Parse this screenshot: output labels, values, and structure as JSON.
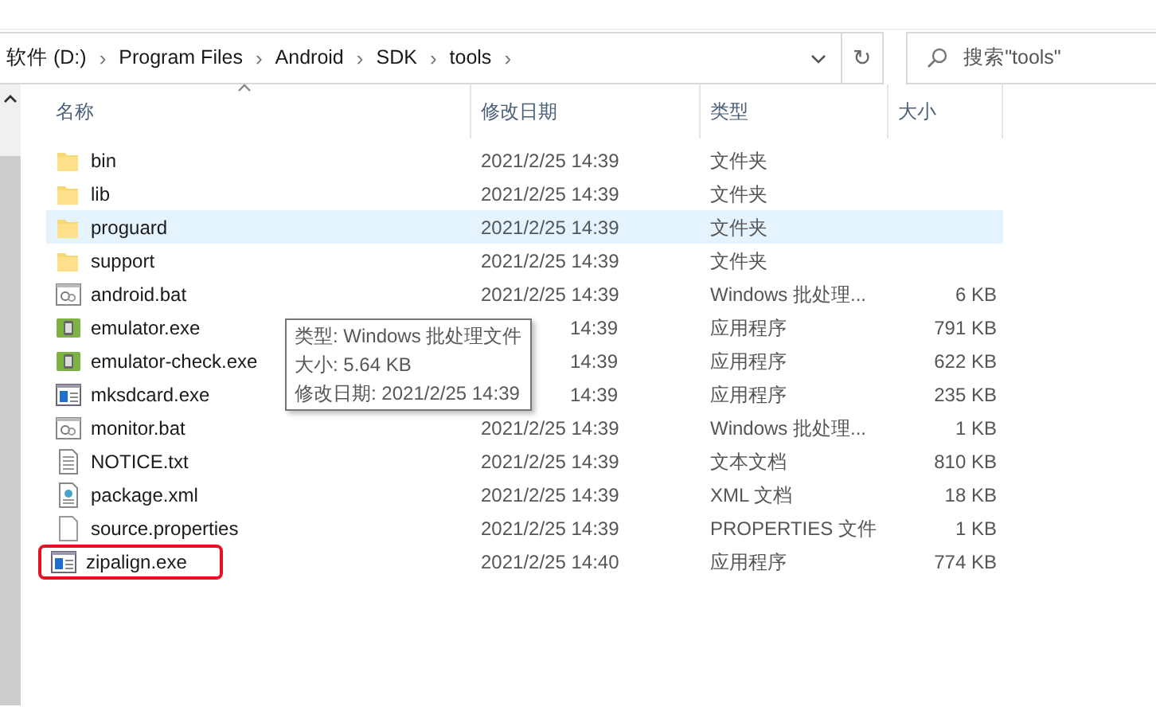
{
  "address_bar": {
    "crumbs": [
      "软件 (D:)",
      "Program Files",
      "Android",
      "SDK",
      "tools"
    ],
    "separator": "›",
    "refresh": "↻"
  },
  "search": {
    "placeholder": "搜索\"tools\""
  },
  "columns": [
    {
      "label": "名称",
      "sorted": true
    },
    {
      "label": "修改日期",
      "sorted": false
    },
    {
      "label": "类型",
      "sorted": false
    },
    {
      "label": "大小",
      "sorted": false
    }
  ],
  "files": [
    {
      "name": "bin",
      "kind": "folder",
      "date": "2021/2/25 14:39",
      "type": "文件夹",
      "hovered": false,
      "marked": false
    },
    {
      "name": "lib",
      "kind": "folder",
      "date": "2021/2/25 14:39",
      "type": "文件夹",
      "hovered": false,
      "marked": false
    },
    {
      "name": "proguard",
      "kind": "folder",
      "date": "2021/2/25 14:39",
      "type": "文件夹",
      "hovered": true,
      "marked": false
    },
    {
      "name": "support",
      "kind": "folder",
      "date": "2021/2/25 14:39",
      "type": "文件夹",
      "hovered": false,
      "marked": false
    },
    {
      "name": "android.bat",
      "kind": "batch",
      "date": "2021/2/25 14:39",
      "type": "Windows 批处理...",
      "size": "6 KB",
      "hovered": false,
      "marked": false
    },
    {
      "name": "emulator.exe",
      "kind": "emulator",
      "date": "14:39",
      "covered": true,
      "type": "应用程序",
      "size": "791 KB",
      "hovered": false,
      "marked": false
    },
    {
      "name": "emulator-check.exe",
      "kind": "emulator",
      "date": "14:39",
      "covered": true,
      "type": "应用程序",
      "size": "622 KB",
      "hovered": false,
      "marked": false
    },
    {
      "name": "mksdcard.exe",
      "kind": "app",
      "date": "14:39",
      "covered": true,
      "type": "应用程序",
      "size": "235 KB",
      "hovered": false,
      "marked": false
    },
    {
      "name": "monitor.bat",
      "kind": "batch",
      "date": "2021/2/25 14:39",
      "type": "Windows 批处理...",
      "size": "1 KB",
      "hovered": false,
      "marked": false
    },
    {
      "name": "NOTICE.txt",
      "kind": "text",
      "date": "2021/2/25 14:39",
      "type": "文本文档",
      "size": "810 KB",
      "hovered": false,
      "marked": false
    },
    {
      "name": "package.xml",
      "kind": "xml",
      "date": "2021/2/25 14:39",
      "type": "XML 文档",
      "size": "18 KB",
      "hovered": false,
      "marked": false
    },
    {
      "name": "source.properties",
      "kind": "blank",
      "date": "2021/2/25 14:39",
      "type": "PROPERTIES 文件",
      "size": "1 KB",
      "hovered": false,
      "marked": false
    },
    {
      "name": "zipalign.exe",
      "kind": "app",
      "date": "2021/2/25 14:40",
      "type": "应用程序",
      "size": "774 KB",
      "hovered": false,
      "marked": true
    }
  ],
  "tooltip": {
    "lines": [
      "类型: Windows 批处理文件",
      "大小: 5.64 KB",
      "修改日期: 2021/2/25 14:39"
    ]
  }
}
